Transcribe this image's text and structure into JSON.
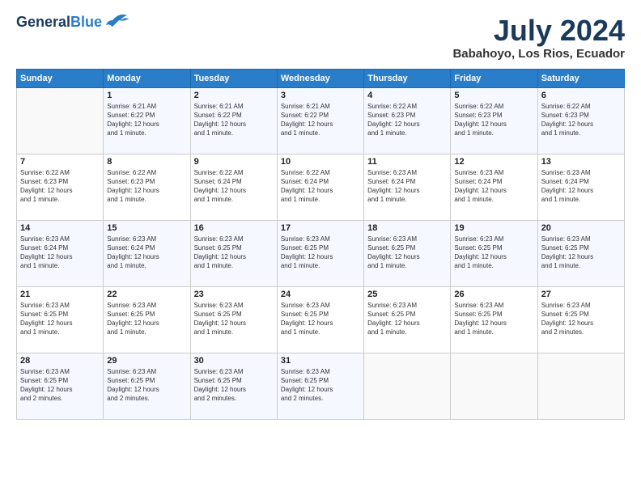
{
  "header": {
    "logo_line1": "General",
    "logo_line2": "Blue",
    "month_year": "July 2024",
    "location": "Babahoyo, Los Rios, Ecuador"
  },
  "days_of_week": [
    "Sunday",
    "Monday",
    "Tuesday",
    "Wednesday",
    "Thursday",
    "Friday",
    "Saturday"
  ],
  "weeks": [
    [
      {
        "day": "",
        "info": ""
      },
      {
        "day": "1",
        "info": "Sunrise: 6:21 AM\nSunset: 6:22 PM\nDaylight: 12 hours\nand 1 minute."
      },
      {
        "day": "2",
        "info": "Sunrise: 6:21 AM\nSunset: 6:22 PM\nDaylight: 12 hours\nand 1 minute."
      },
      {
        "day": "3",
        "info": "Sunrise: 6:21 AM\nSunset: 6:22 PM\nDaylight: 12 hours\nand 1 minute."
      },
      {
        "day": "4",
        "info": "Sunrise: 6:22 AM\nSunset: 6:23 PM\nDaylight: 12 hours\nand 1 minute."
      },
      {
        "day": "5",
        "info": "Sunrise: 6:22 AM\nSunset: 6:23 PM\nDaylight: 12 hours\nand 1 minute."
      },
      {
        "day": "6",
        "info": "Sunrise: 6:22 AM\nSunset: 6:23 PM\nDaylight: 12 hours\nand 1 minute."
      }
    ],
    [
      {
        "day": "7",
        "info": "Sunrise: 6:22 AM\nSunset: 6:23 PM\nDaylight: 12 hours\nand 1 minute."
      },
      {
        "day": "8",
        "info": "Sunrise: 6:22 AM\nSunset: 6:23 PM\nDaylight: 12 hours\nand 1 minute."
      },
      {
        "day": "9",
        "info": "Sunrise: 6:22 AM\nSunset: 6:24 PM\nDaylight: 12 hours\nand 1 minute."
      },
      {
        "day": "10",
        "info": "Sunrise: 6:22 AM\nSunset: 6:24 PM\nDaylight: 12 hours\nand 1 minute."
      },
      {
        "day": "11",
        "info": "Sunrise: 6:23 AM\nSunset: 6:24 PM\nDaylight: 12 hours\nand 1 minute."
      },
      {
        "day": "12",
        "info": "Sunrise: 6:23 AM\nSunset: 6:24 PM\nDaylight: 12 hours\nand 1 minute."
      },
      {
        "day": "13",
        "info": "Sunrise: 6:23 AM\nSunset: 6:24 PM\nDaylight: 12 hours\nand 1 minute."
      }
    ],
    [
      {
        "day": "14",
        "info": "Sunrise: 6:23 AM\nSunset: 6:24 PM\nDaylight: 12 hours\nand 1 minute."
      },
      {
        "day": "15",
        "info": "Sunrise: 6:23 AM\nSunset: 6:24 PM\nDaylight: 12 hours\nand 1 minute."
      },
      {
        "day": "16",
        "info": "Sunrise: 6:23 AM\nSunset: 6:25 PM\nDaylight: 12 hours\nand 1 minute."
      },
      {
        "day": "17",
        "info": "Sunrise: 6:23 AM\nSunset: 6:25 PM\nDaylight: 12 hours\nand 1 minute."
      },
      {
        "day": "18",
        "info": "Sunrise: 6:23 AM\nSunset: 6:25 PM\nDaylight: 12 hours\nand 1 minute."
      },
      {
        "day": "19",
        "info": "Sunrise: 6:23 AM\nSunset: 6:25 PM\nDaylight: 12 hours\nand 1 minute."
      },
      {
        "day": "20",
        "info": "Sunrise: 6:23 AM\nSunset: 6:25 PM\nDaylight: 12 hours\nand 1 minute."
      }
    ],
    [
      {
        "day": "21",
        "info": "Sunrise: 6:23 AM\nSunset: 6:25 PM\nDaylight: 12 hours\nand 1 minute."
      },
      {
        "day": "22",
        "info": "Sunrise: 6:23 AM\nSunset: 6:25 PM\nDaylight: 12 hours\nand 1 minute."
      },
      {
        "day": "23",
        "info": "Sunrise: 6:23 AM\nSunset: 6:25 PM\nDaylight: 12 hours\nand 1 minute."
      },
      {
        "day": "24",
        "info": "Sunrise: 6:23 AM\nSunset: 6:25 PM\nDaylight: 12 hours\nand 1 minute."
      },
      {
        "day": "25",
        "info": "Sunrise: 6:23 AM\nSunset: 6:25 PM\nDaylight: 12 hours\nand 1 minute."
      },
      {
        "day": "26",
        "info": "Sunrise: 6:23 AM\nSunset: 6:25 PM\nDaylight: 12 hours\nand 1 minute."
      },
      {
        "day": "27",
        "info": "Sunrise: 6:23 AM\nSunset: 6:25 PM\nDaylight: 12 hours\nand 2 minutes."
      }
    ],
    [
      {
        "day": "28",
        "info": "Sunrise: 6:23 AM\nSunset: 6:25 PM\nDaylight: 12 hours\nand 2 minutes."
      },
      {
        "day": "29",
        "info": "Sunrise: 6:23 AM\nSunset: 6:25 PM\nDaylight: 12 hours\nand 2 minutes."
      },
      {
        "day": "30",
        "info": "Sunrise: 6:23 AM\nSunset: 6:25 PM\nDaylight: 12 hours\nand 2 minutes."
      },
      {
        "day": "31",
        "info": "Sunrise: 6:23 AM\nSunset: 6:25 PM\nDaylight: 12 hours\nand 2 minutes."
      },
      {
        "day": "",
        "info": ""
      },
      {
        "day": "",
        "info": ""
      },
      {
        "day": "",
        "info": ""
      }
    ]
  ]
}
